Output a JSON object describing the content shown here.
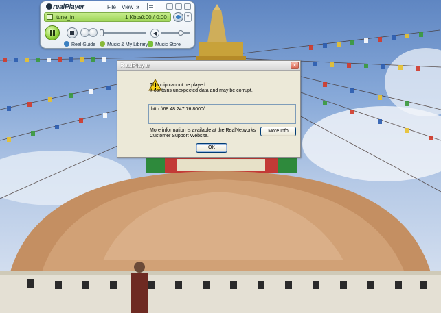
{
  "player": {
    "brand": "realPlayer",
    "menu": {
      "file": "File",
      "view": "View",
      "overflow": "»"
    },
    "display": {
      "clip_title": "tune_in",
      "bitrate": "1 Kbps",
      "time": "0:00 / 0:00"
    },
    "seek_position": 0,
    "volume_level": 0.72,
    "nav": {
      "guide": "Real Guide",
      "library": "Music & My Library",
      "store": "Music Store"
    },
    "icons": [
      "now-playing-icon",
      "minimize-icon",
      "restore-icon",
      "close-icon",
      "clip-icon",
      "network-icon",
      "chevron-down-icon",
      "pause-icon",
      "stop-icon",
      "rewind-icon",
      "fast-forward-icon",
      "speaker-icon",
      "globe-icon",
      "music-note-icon"
    ],
    "colors": {
      "display": "#a7da62",
      "play": "#90d03a"
    }
  },
  "dialog": {
    "title": "RealPlayer",
    "close": "✕",
    "message_line1": "This clip cannot be played.",
    "message_line2": "It contains unexpected data and may be corrupt.",
    "url": "http://68.48.247.76:8000/",
    "info_line1": "More information is available at the RealNetworks",
    "info_line2": "Customer Support Website.",
    "more_info_label": "More Info",
    "ok_label": "OK",
    "icons": [
      "warning-icon"
    ]
  }
}
